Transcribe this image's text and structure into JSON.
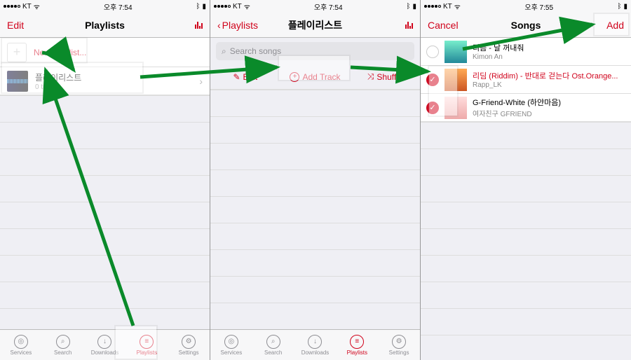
{
  "status": {
    "carrier": "KT",
    "time1": "오후 7:54",
    "time2": "오후 7:54",
    "time3": "오후 7:55"
  },
  "screen1": {
    "nav": {
      "left": "Edit",
      "title": "Playlists"
    },
    "newpl": "New Playlist...",
    "pl": {
      "name": "플레이리스트",
      "sub": "0 tracks"
    }
  },
  "screen2": {
    "nav": {
      "back": "Playlists",
      "title": "플레이리스트"
    },
    "search": "Search songs",
    "tools": {
      "edit": "Edit",
      "add": "Add Track",
      "shuffle": "Shuffle"
    }
  },
  "screen3": {
    "nav": {
      "cancel": "Cancel",
      "title": "Songs",
      "add": "Add"
    },
    "songs": [
      {
        "title": "리듬 - 날 꺼내줘",
        "artist": "Kimon An",
        "selected": false
      },
      {
        "title": "리딤 (Riddim) - 반대로 걷는다 Ost.Orange...",
        "artist": "Rapp_LK",
        "selected": true
      },
      {
        "title": "G-Friend-White (하얀마음)",
        "artist": "여자친구 GFRIEND",
        "selected": true
      }
    ]
  },
  "tabs": [
    {
      "label": "Services",
      "glyph": "◎"
    },
    {
      "label": "Search",
      "glyph": "⌕"
    },
    {
      "label": "Downloads",
      "glyph": "↓"
    },
    {
      "label": "Playlists",
      "glyph": "≡"
    },
    {
      "label": "Settings",
      "glyph": "⚙"
    }
  ]
}
